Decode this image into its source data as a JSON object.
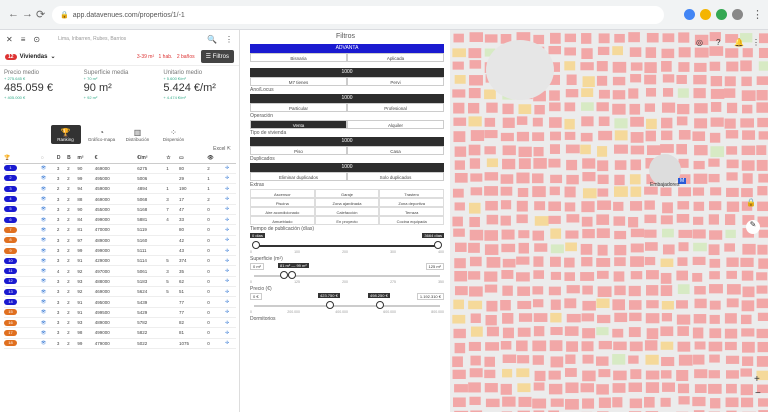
{
  "browser": {
    "url": "app.datavenues.com/propertios/1/-1",
    "lock": "🔒"
  },
  "topbar": {
    "search_placeholder": "Lima, Iribarren, Rubes, Barrios",
    "close": "✕",
    "menu": "≡",
    "history": "⊙",
    "search": "🔍"
  },
  "header": {
    "count": "12",
    "type_label": "Viviendas",
    "chips": [
      "3-39 m²",
      "1 hab.",
      "2 baños"
    ],
    "filters_label": "Filtros"
  },
  "stats": [
    {
      "label": "Precio medio",
      "sub1": "+ 275.645 €",
      "value": "485.059 €",
      "sub2": "+ 405.000 €"
    },
    {
      "label": "Superficie media",
      "sub1": "+ 70 m²",
      "value": "90 m²",
      "sub2": "+ 92 m²"
    },
    {
      "label": "Unitario medio",
      "sub1": "+ 5.600 €/m²",
      "value": "5.424 €/m²",
      "sub2": "+ 4.474 €/m²"
    }
  ],
  "tabs": [
    {
      "label": "Ranking",
      "icon": "🏆"
    },
    {
      "label": "Gráfico-mapa",
      "icon": "◔"
    },
    {
      "label": "Distribución",
      "icon": "▥"
    },
    {
      "label": "Dispersión",
      "icon": "⁘"
    }
  ],
  "excel": {
    "label": "Excel",
    "icon": "⇱"
  },
  "table": {
    "headers": [
      "🏆",
      "◌",
      "D",
      "B",
      "m²",
      "€",
      "€/m²",
      "☆",
      "▭",
      "👁",
      ""
    ],
    "rows": [
      {
        "rk": "1",
        "c": "#1a1ad0",
        "d": "3",
        "b": "2",
        "m": "90",
        "p": "469000",
        "u": "6275",
        "s": "1",
        "t": "80",
        "v": "2"
      },
      {
        "rk": "2",
        "c": "#1a1ad0",
        "d": "3",
        "b": "2",
        "m": "99",
        "p": "495000",
        "u": "5006",
        "s": "",
        "t": "29",
        "v": "1"
      },
      {
        "rk": "3",
        "c": "#1a1ad0",
        "d": "2",
        "b": "2",
        "m": "94",
        "p": "459000",
        "u": "4894",
        "s": "1",
        "t": "190",
        "v": "1"
      },
      {
        "rk": "4",
        "c": "#1a1ad0",
        "d": "3",
        "b": "2",
        "m": "88",
        "p": "469000",
        "u": "5068",
        "s": "3",
        "t": "17",
        "v": "2"
      },
      {
        "rk": "5",
        "c": "#1a1ad0",
        "d": "3",
        "b": "2",
        "m": "90",
        "p": "455000",
        "u": "5168",
        "s": "7",
        "t": "47",
        "v": "0"
      },
      {
        "rk": "6",
        "c": "#1a1ad0",
        "d": "3",
        "b": "2",
        "m": "84",
        "p": "499000",
        "u": "5881",
        "s": "4",
        "t": "33",
        "v": "0"
      },
      {
        "rk": "7",
        "c": "#e07020",
        "d": "2",
        "b": "2",
        "m": "81",
        "p": "470000",
        "u": "5119",
        "s": "",
        "t": "80",
        "v": "0"
      },
      {
        "rk": "8",
        "c": "#e07020",
        "d": "3",
        "b": "2",
        "m": "97",
        "p": "489000",
        "u": "5160",
        "s": "",
        "t": "42",
        "v": "0"
      },
      {
        "rk": "9",
        "c": "#e07020",
        "d": "3",
        "b": "2",
        "m": "99",
        "p": "499000",
        "u": "5111",
        "s": "",
        "t": "43",
        "v": "0"
      },
      {
        "rk": "10",
        "c": "#1a1ad0",
        "d": "3",
        "b": "2",
        "m": "91",
        "p": "429000",
        "u": "5114",
        "s": "5",
        "t": "374",
        "v": "0"
      },
      {
        "rk": "11",
        "c": "#1a1ad0",
        "d": "4",
        "b": "2",
        "m": "92",
        "p": "497000",
        "u": "5061",
        "s": "3",
        "t": "35",
        "v": "0"
      },
      {
        "rk": "12",
        "c": "#1a1ad0",
        "d": "3",
        "b": "2",
        "m": "93",
        "p": "488000",
        "u": "5183",
        "s": "5",
        "t": "62",
        "v": "0"
      },
      {
        "rk": "13",
        "c": "#1a1ad0",
        "d": "3",
        "b": "2",
        "m": "92",
        "p": "469000",
        "u": "5624",
        "s": "5",
        "t": "51",
        "v": "0"
      },
      {
        "rk": "14",
        "c": "#1a1ad0",
        "d": "3",
        "b": "2",
        "m": "91",
        "p": "495000",
        "u": "5439",
        "s": "",
        "t": "77",
        "v": "0"
      },
      {
        "rk": "15",
        "c": "#e07020",
        "d": "3",
        "b": "2",
        "m": "91",
        "p": "499500",
        "u": "5429",
        "s": "",
        "t": "77",
        "v": "0"
      },
      {
        "rk": "16",
        "c": "#e07020",
        "d": "3",
        "b": "2",
        "m": "93",
        "p": "489000",
        "u": "5782",
        "s": "",
        "t": "82",
        "v": "0"
      },
      {
        "rk": "17",
        "c": "#e07020",
        "d": "3",
        "b": "2",
        "m": "98",
        "p": "499000",
        "u": "5822",
        "s": "",
        "t": "81",
        "v": "0"
      },
      {
        "rk": "18",
        "c": "#e07020",
        "d": "3",
        "b": "2",
        "m": "99",
        "p": "479000",
        "u": "5022",
        "s": "",
        "t": "1075",
        "v": "0"
      }
    ]
  },
  "filters": {
    "title": "Filtros",
    "s1": {
      "title": "ADVANTA",
      "opts": [
        "Bisnaria",
        "Aplicada"
      ]
    },
    "s2": {
      "title": "1000",
      "opts": [
        "M7 tienes",
        "Pervi"
      ]
    },
    "anyloc_label": "Ano/Locus",
    "s3": {
      "title": "1000",
      "opts": [
        "Particular",
        "Profesional"
      ]
    },
    "op_label": "Operación",
    "op_opts": [
      "Venta",
      "Alquiler"
    ],
    "tipo_label": "Tipo de vivienda",
    "s4": {
      "title": "1000",
      "opts": [
        "Piso",
        "Casa"
      ]
    },
    "dup_label": "Duplicados",
    "s5": {
      "title": "1000",
      "opts": [
        "Eliminar duplicados",
        "Solo duplicados"
      ]
    },
    "extras_label": "Extras",
    "extras": [
      "Ascensor",
      "Garaje",
      "Trastero",
      "Piscina",
      "Zona ajardinada",
      "Zona deportiva",
      "Aire acondicionado",
      "Calefacción",
      "Terraza",
      "Amueblado",
      "En proyecto",
      "Cocina equipada"
    ],
    "time_label": "Tiempo de publicación (días)",
    "time_min": "0 días",
    "time_max": "3664 días",
    "time_ticks": [
      "0",
      "100",
      "200",
      "300",
      "400"
    ],
    "area_label": "Superficie (m²)",
    "area_min": "0 m²",
    "area_sel": "81 m² — 99 m²",
    "area_max": "125 m²",
    "area_ticks": [
      "0",
      "125",
      "200",
      "275",
      "350"
    ],
    "price_label": "Precio (€)",
    "price_min": "0 €",
    "price_a": "423.750 €",
    "price_b": "498.250 €",
    "price_max": "1.192.310 €",
    "price_ticks": [
      "0",
      "200.000",
      "400.000",
      "600.000",
      "800.000"
    ],
    "next_label": "Dormitorios"
  },
  "map": {
    "metro1": "Embajadores",
    "metro2": "M",
    "zoom_in": "+",
    "zoom_out": "−",
    "lock": "🔒",
    "pen": "✎"
  }
}
